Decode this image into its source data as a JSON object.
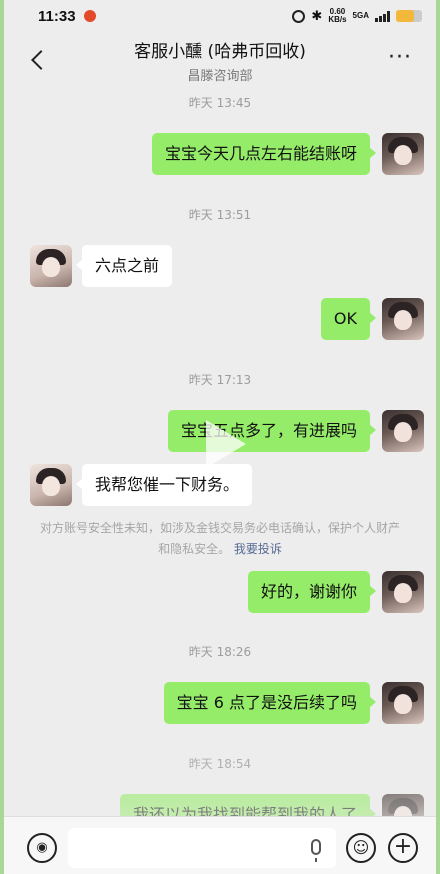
{
  "status_bar": {
    "time": "11:33",
    "net_speed_value": "0.60",
    "net_speed_unit": "KB/s",
    "network": "5GA",
    "bluetooth": "✱"
  },
  "header": {
    "title": "客服小醺 (哈弗币回收)",
    "subtitle": "昌滕咨询部",
    "more": "···"
  },
  "messages": [
    {
      "type": "timestamp",
      "text": "昨天 13:45"
    },
    {
      "type": "me",
      "text": "宝宝今天几点左右能结账呀"
    },
    {
      "type": "timestamp",
      "text": "昨天 13:51"
    },
    {
      "type": "them",
      "text": "六点之前"
    },
    {
      "type": "me",
      "text": "OK"
    },
    {
      "type": "timestamp",
      "text": "昨天 17:13"
    },
    {
      "type": "me",
      "text": "宝宝五点多了，有进展吗"
    },
    {
      "type": "them",
      "text": "我帮您催一下财务。"
    },
    {
      "type": "system",
      "text": "对方账号安全性未知，如涉及金钱交易务必电话确认，保护个人财产和隐私安全。",
      "link": "我要投诉"
    },
    {
      "type": "me",
      "text": "好的，谢谢你"
    },
    {
      "type": "timestamp",
      "text": "昨天 18:26"
    },
    {
      "type": "me",
      "text": "宝宝 6 点了是没后续了吗"
    },
    {
      "type": "timestamp",
      "text": "昨天 18:54"
    },
    {
      "type": "me",
      "text": "我还以为我找到能帮到我的人了"
    }
  ],
  "input_bar": {
    "plus": "+",
    "emoji": "☺"
  },
  "colors": {
    "my_bubble": "#95ec69",
    "their_bubble": "#ffffff",
    "background": "#ededed",
    "link": "#576b95"
  }
}
